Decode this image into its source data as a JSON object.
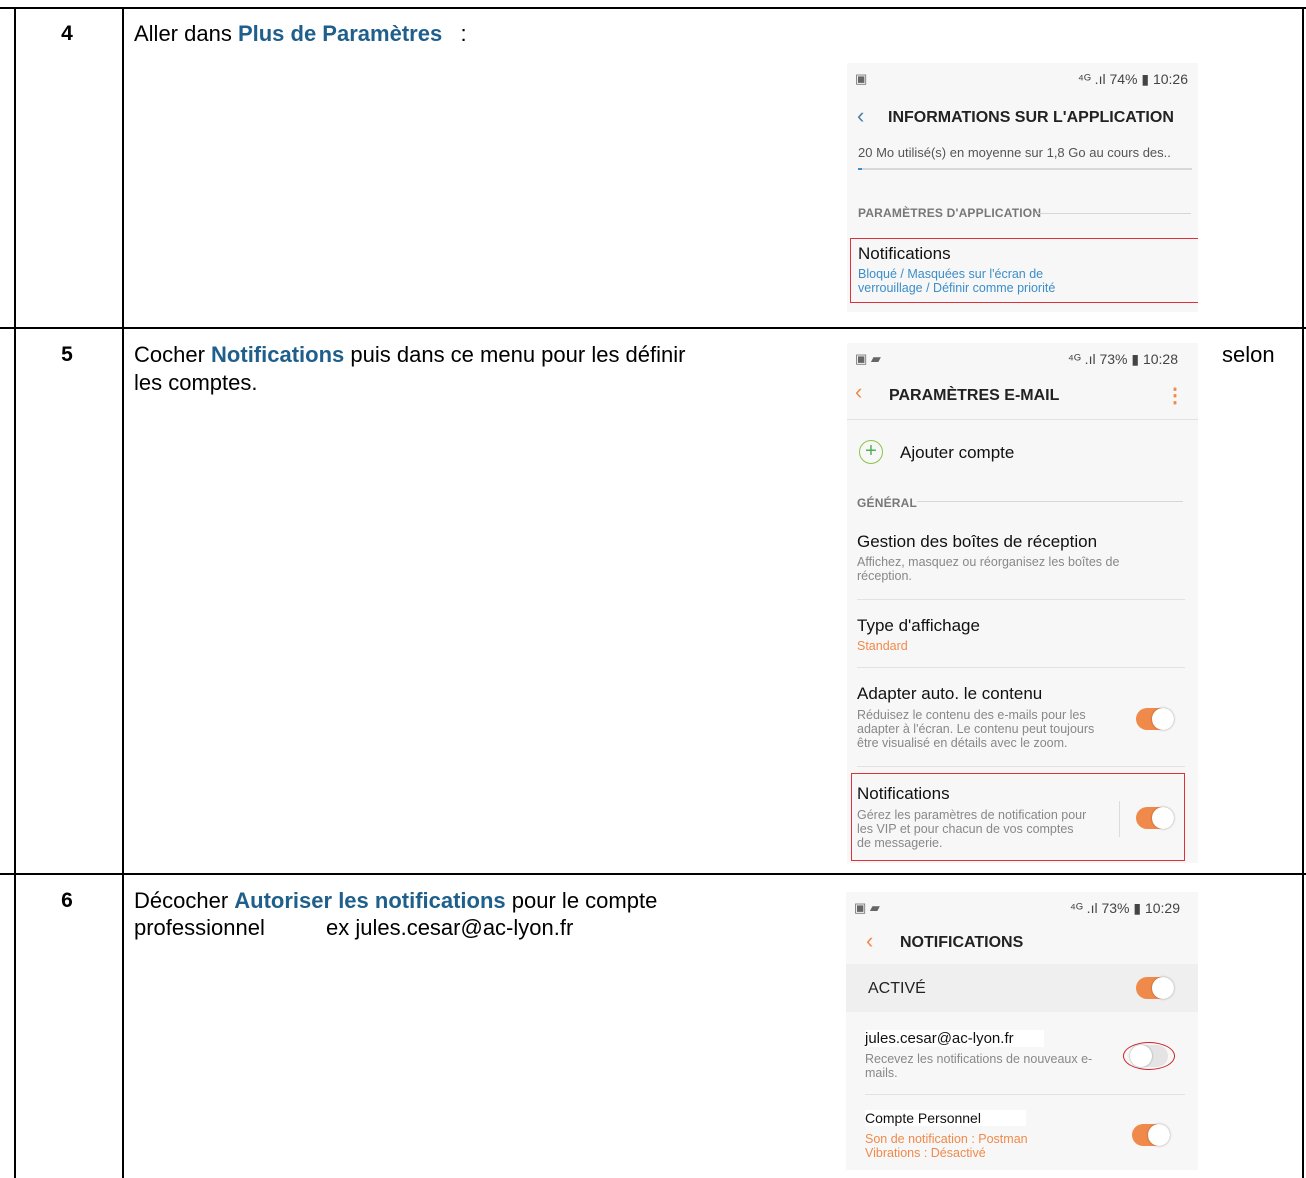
{
  "rows": [
    {
      "step": "4",
      "text_before": "Aller dans ",
      "keyword": "Plus de Paramètres",
      "text_after": "   :",
      "phone": {
        "status_right": "⁴ᴳ .ıl 74% ▮ 10:26",
        "title": "INFORMATIONS SUR L'APPLICATION",
        "usage": "20 Mo utilisé(s) en moyenne sur 1,8 Go au cours des..",
        "section": "PARAMÈTRES D'APPLICATION",
        "notif_title": "Notifications",
        "notif_desc_1": "Bloqué / Masquées sur l'écran de",
        "notif_desc_2": "verrouillage / Définir comme priorité"
      }
    },
    {
      "step": "5",
      "text_before": "Cocher ",
      "keyword": "Notifications",
      "text_after_1": " puis dans ce menu pour les définir",
      "text_after_2": "les comptes.",
      "trailing": "selon",
      "phone": {
        "status_right": "⁴ᴳ .ıl 73% ▮ 10:28",
        "title": "PARAMÈTRES E-MAIL",
        "add_account": "Ajouter compte",
        "section": "GÉNÉRAL",
        "inbox_title": "Gestion des boîtes de réception",
        "inbox_desc_1": "Affichez, masquez ou réorganisez les boîtes de",
        "inbox_desc_2": "réception.",
        "display_title": "Type d'affichage",
        "display_value": "Standard",
        "fit_title": "Adapter auto. le contenu",
        "fit_desc_1": "Réduisez le contenu des e-mails pour les",
        "fit_desc_2": "adapter à l'écran. Le contenu peut toujours",
        "fit_desc_3": "être visualisé en détails avec le zoom.",
        "fit_toggle_on": true,
        "notif_title": "Notifications",
        "notif_desc_1": "Gérez les paramètres de notification pour",
        "notif_desc_2": "les VIP et pour chacun de vos comptes",
        "notif_desc_3": "de messagerie.",
        "notif_toggle_on": true
      }
    },
    {
      "step": "6",
      "text_before": "Décocher ",
      "keyword": "Autoriser les notifications",
      "text_after_1": " pour le compte",
      "text_after_2": "professionnel          ex jules.cesar@ac-lyon.fr",
      "phone": {
        "status_right": "⁴ᴳ .ıl 73% ▮ 10:29",
        "title": "NOTIFICATIONS",
        "active_label": "ACTIVÉ",
        "active_toggle_on": true,
        "account1_title": "jules.cesar@ac-lyon.fr",
        "account1_desc_1": "Recevez les notifications de nouveaux e-",
        "account1_desc_2": "mails.",
        "account1_toggle_on": false,
        "account2_title": "Compte Personnel",
        "account2_desc_1": "Son de notification : Postman",
        "account2_desc_2": "Vibrations : Désactivé",
        "account2_toggle_on": true
      }
    }
  ],
  "colors": {
    "keyword": "#1f5f8b",
    "accent_orange": "#f08a4b",
    "highlight_red": "#e0303a",
    "link_blue": "#3b8ec9"
  }
}
